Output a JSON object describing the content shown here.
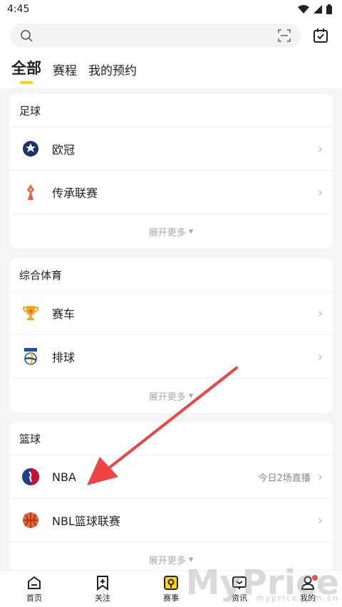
{
  "status": {
    "time": "4:45"
  },
  "tabs": [
    {
      "label": "全部"
    },
    {
      "label": "赛程"
    },
    {
      "label": "我的预约"
    }
  ],
  "sections": [
    {
      "title": "足球",
      "items": [
        {
          "label": "欧冠"
        },
        {
          "label": "传承联赛"
        }
      ],
      "more": "展开更多"
    },
    {
      "title": "综合体育",
      "items": [
        {
          "label": "赛车"
        },
        {
          "label": "排球"
        }
      ],
      "more": "展开更多"
    },
    {
      "title": "篮球",
      "items": [
        {
          "label": "NBA",
          "extra": "今日2场直播"
        },
        {
          "label": "NBL篮球联赛"
        }
      ],
      "more": "展开更多"
    }
  ],
  "nav": [
    {
      "label": "首页"
    },
    {
      "label": "关注"
    },
    {
      "label": "赛事"
    },
    {
      "label": "资讯"
    },
    {
      "label": "我的"
    }
  ],
  "watermark": "MyPrice",
  "watermark_sub": "myprice.com.cn",
  "colors": {
    "accent": "#ffd400",
    "arrow": "#ee4444"
  }
}
